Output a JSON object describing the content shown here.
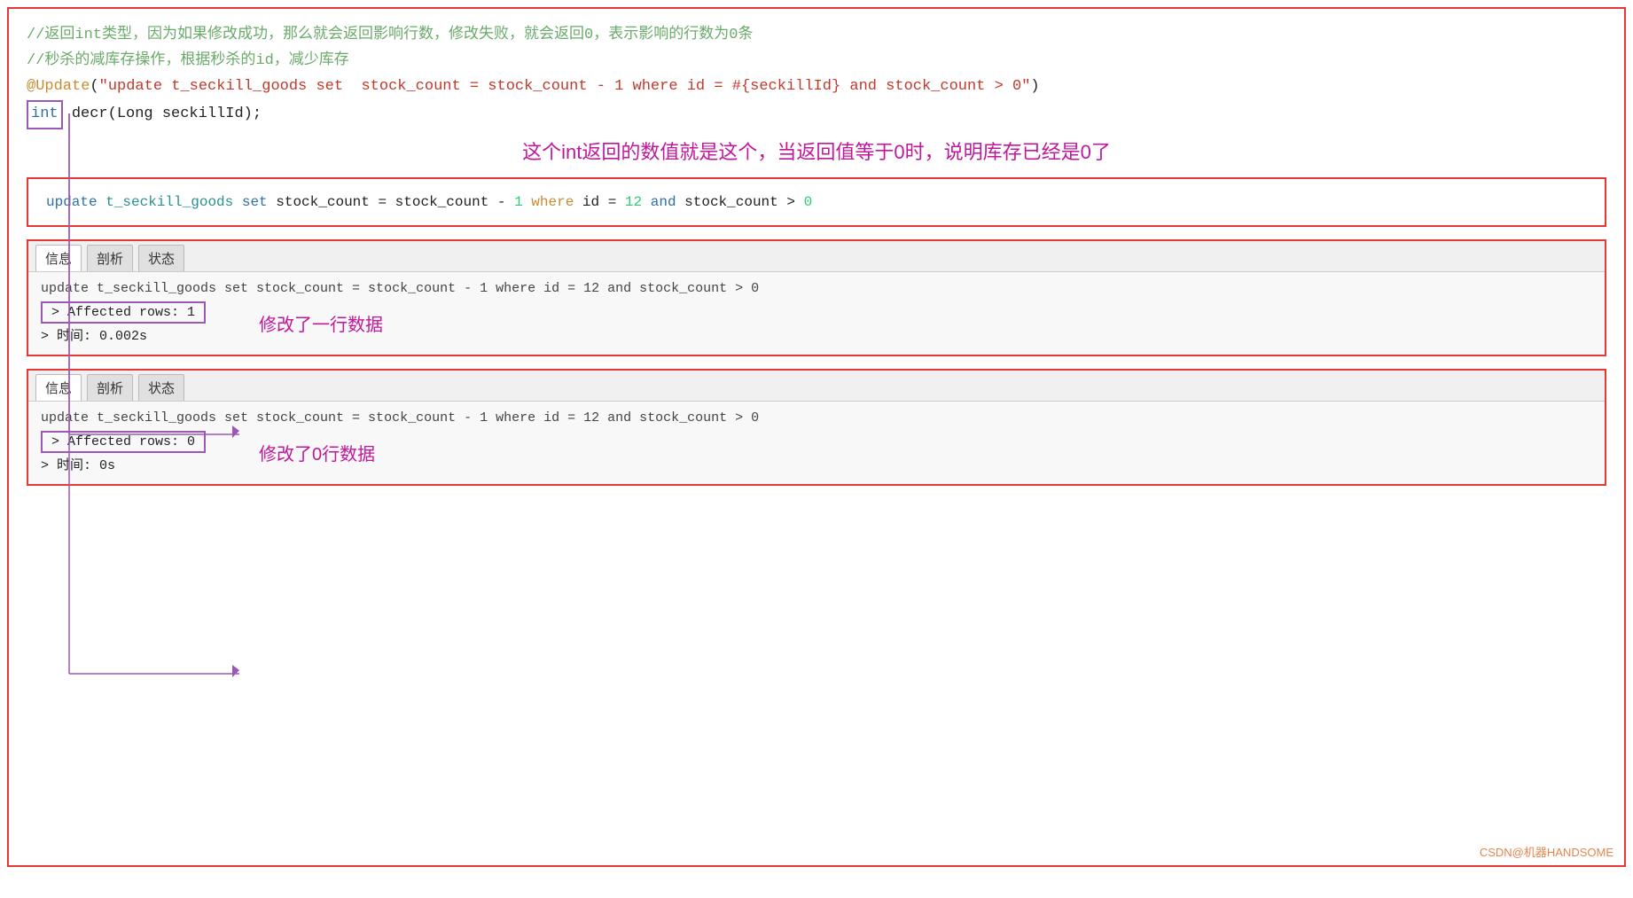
{
  "outer": {
    "border_color": "#e53935"
  },
  "comments": [
    "//返回int类型，因为如果修改成功，那么就会返回影响行数，修改失败，就会返回0，表示影响的行数为0条",
    "//秒杀的减库存操作，根据秒杀的id，减少库存"
  ],
  "annotation_line": "@Update(\"update t_seckill_goods set  stock_count = stock_count - 1 where id = #{seckillId} and stock_count > 0\")",
  "int_line": "int decr(Long seckillId);",
  "int_keyword": "int",
  "chinese_label1": "这个int返回的数值就是这个，当返回值等于0时，说明库存已经是0了",
  "sql_box": {
    "text": "update t_seckill_goods set stock_count = stock_count - 1 where id = 12 and stock_count > 0"
  },
  "result_box1": {
    "tabs": [
      "信息",
      "剖析",
      "状态"
    ],
    "active_tab": "信息",
    "query": "update t_seckill_goods set stock_count = stock_count - 1 where id = 12 and stock_count > 0",
    "affected_rows": "> Affected rows: 1",
    "time": "> 时间: 0.002s",
    "label": "修改了一行数据"
  },
  "result_box2": {
    "tabs": [
      "信息",
      "剖析",
      "状态"
    ],
    "active_tab": "信息",
    "query": "update t_seckill_goods set stock_count = stock_count - 1 where id = 12 and stock_count > 0",
    "affected_rows": "> Affected rows: 0",
    "time": "> 时间: 0s",
    "label": "修改了0行数据"
  },
  "watermark": "CSDN@机器HANDSOME"
}
